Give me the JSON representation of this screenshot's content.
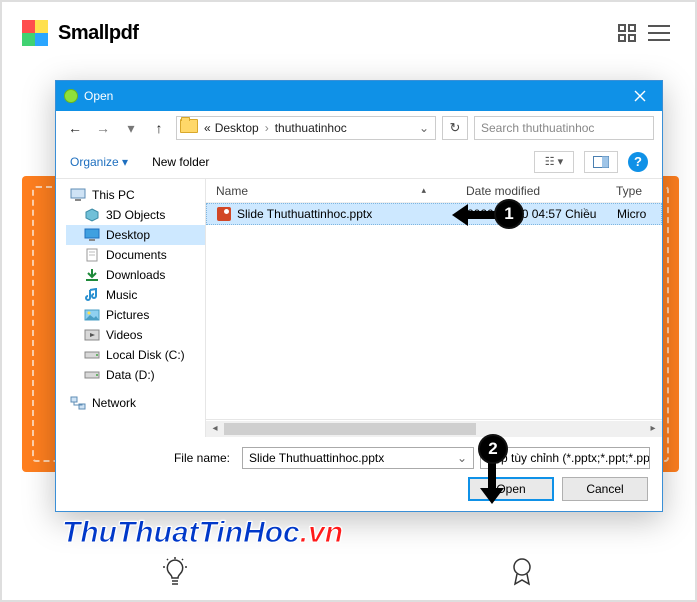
{
  "app": {
    "brand": "Smallpdf"
  },
  "logo_colors": [
    "#ff4d4d",
    "#ffe04d",
    "#40d272",
    "#2aa6ff"
  ],
  "dialog": {
    "title": "Open",
    "nav": {
      "crumbs": [
        "Desktop",
        "thuthuatinhoc"
      ],
      "crumb_prefix": "«"
    },
    "search_placeholder": "Search thuthuatinhoc",
    "cmd": {
      "organize": "Organize ▾",
      "newfolder": "New folder"
    },
    "view_label": "☷ ▾",
    "columns": {
      "name": "Name",
      "date": "Date modified",
      "type": "Type"
    },
    "tree": [
      {
        "label": "This PC",
        "icon": "pc"
      },
      {
        "label": "3D Objects",
        "icon": "3d"
      },
      {
        "label": "Desktop",
        "icon": "desktop",
        "selected": true
      },
      {
        "label": "Documents",
        "icon": "docs"
      },
      {
        "label": "Downloads",
        "icon": "dl"
      },
      {
        "label": "Music",
        "icon": "music"
      },
      {
        "label": "Pictures",
        "icon": "pics"
      },
      {
        "label": "Videos",
        "icon": "vids"
      },
      {
        "label": "Local Disk (C:)",
        "icon": "disk"
      },
      {
        "label": "Data (D:)",
        "icon": "disk"
      },
      {
        "label": "Network",
        "icon": "net"
      }
    ],
    "file": {
      "name": "Slide Thuthuattinhoc.pptx",
      "date": "2020-05-20 04:57 Chiều",
      "type": "Micro"
    },
    "footer": {
      "filename_label": "File name:",
      "filename_value": "Slide Thuthuattinhoc.pptx",
      "filter": "Tệp tùy chỉnh (*.pptx;*.ppt;*.pp",
      "open": "Open",
      "cancel": "Cancel"
    }
  },
  "annotations": {
    "step1": "1",
    "step2": "2"
  },
  "watermark": {
    "main": "ThuThuatTinHoc",
    "ext": ".vn"
  }
}
